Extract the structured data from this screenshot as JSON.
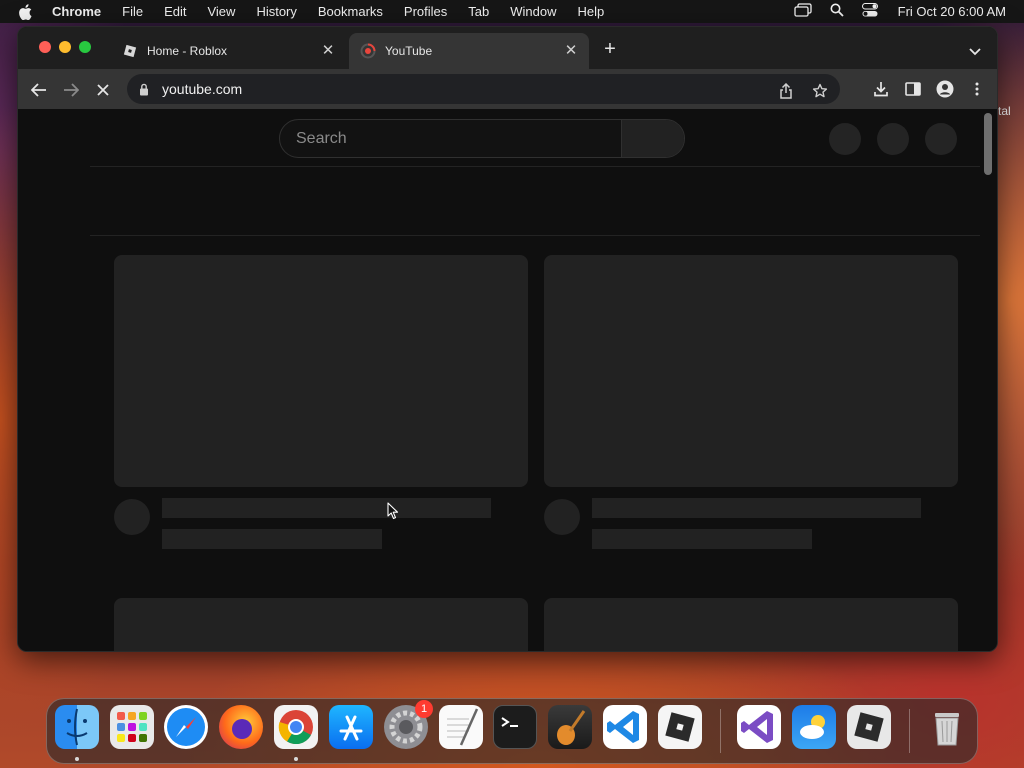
{
  "menubar": {
    "app_name": "Chrome",
    "items": [
      "File",
      "Edit",
      "View",
      "History",
      "Bookmarks",
      "Profiles",
      "Tab",
      "Window",
      "Help"
    ],
    "clock": "Fri Oct 20  6:00 AM"
  },
  "browser": {
    "tabs": [
      {
        "title": "Home - Roblox",
        "active": false
      },
      {
        "title": "YouTube",
        "active": true
      }
    ],
    "url": "youtube.com"
  },
  "page": {
    "search_placeholder": "Search"
  },
  "desktop": {
    "edge_text": "tal"
  },
  "dock": {
    "apps": [
      "Finder",
      "Launchpad",
      "Safari",
      "Firefox",
      "Google Chrome",
      "App Store",
      "System Settings",
      "TextEdit",
      "Terminal",
      "GarageBand",
      "Visual Studio Code",
      "Roblox",
      "Visual Studio",
      "Weather",
      "Roblox Studio",
      "Trash"
    ],
    "system_settings_badge": "1"
  }
}
